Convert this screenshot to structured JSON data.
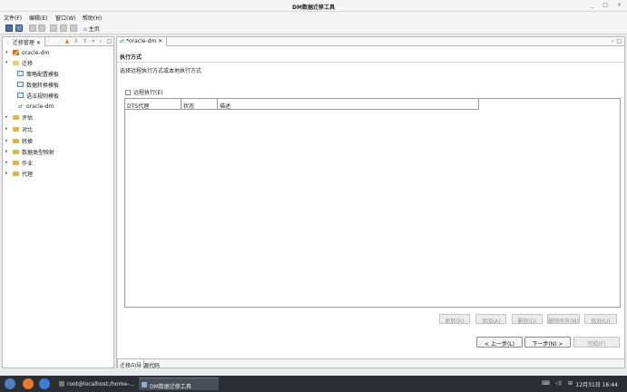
{
  "window": {
    "title": "DM数据迁移工具",
    "controls": [
      "_",
      "□",
      "×"
    ]
  },
  "menu": [
    "文件(F)",
    "编辑(E)",
    "窗口(W)",
    "帮助(H)"
  ],
  "toolbar": {
    "home_label": "主页"
  },
  "left_view": {
    "tab_label": "迁移管理",
    "tree": [
      {
        "label": "oracle-dm",
        "level": 0,
        "icon": "database-icon",
        "expanded": true
      },
      {
        "label": "迁移",
        "level": 1,
        "icon": "folder-icon",
        "expanded": true
      },
      {
        "label": "策略配置模板",
        "level": 2,
        "icon": "template-icon"
      },
      {
        "label": "数据转换模板",
        "level": 2,
        "icon": "template-icon"
      },
      {
        "label": "语法规则模板",
        "level": 2,
        "icon": "template-icon"
      },
      {
        "label": "oracle-dm",
        "level": 2,
        "icon": "migration-link-icon"
      },
      {
        "label": "评估",
        "level": 1,
        "icon": "folder-icon",
        "expanded": false
      },
      {
        "label": "对比",
        "level": 1,
        "icon": "folder-icon",
        "expanded": false
      },
      {
        "label": "转换",
        "level": 1,
        "icon": "folder-icon",
        "expanded": false
      },
      {
        "label": "数据类型映射",
        "level": 1,
        "icon": "folder-icon",
        "expanded": false
      },
      {
        "label": "作业",
        "level": 1,
        "icon": "folder-icon",
        "expanded": false
      },
      {
        "label": "代理",
        "level": 1,
        "icon": "folder-icon",
        "expanded": false
      }
    ]
  },
  "editor": {
    "tab_label": "*oracle-dm",
    "section_title": "执行方式",
    "section_desc": "选择远程执行方式或本地执行方式",
    "remote_checkbox_label": "远程执行(E)",
    "table_headers": [
      "DTS代理",
      "状态",
      "描述"
    ],
    "action_buttons": [
      "刷新(R)",
      "添加(A)",
      "删除(D)",
      "删除所有(M)",
      "修改(U)"
    ],
    "nav_buttons": {
      "back": "< 上一步(L)",
      "next": "下一步(N) >",
      "finish": "完成(F)"
    },
    "bottom_tabs": [
      "迁移向导",
      "源代码"
    ]
  },
  "taskbar": {
    "tasks": [
      "root@localhost:/home-...",
      "DM数据迁移工具"
    ],
    "time": "12月31日 16:44"
  },
  "colors": {
    "accent": "#3a6fb5",
    "taskbar_bg": "#2b2e33",
    "folder": "#e4b63c"
  }
}
